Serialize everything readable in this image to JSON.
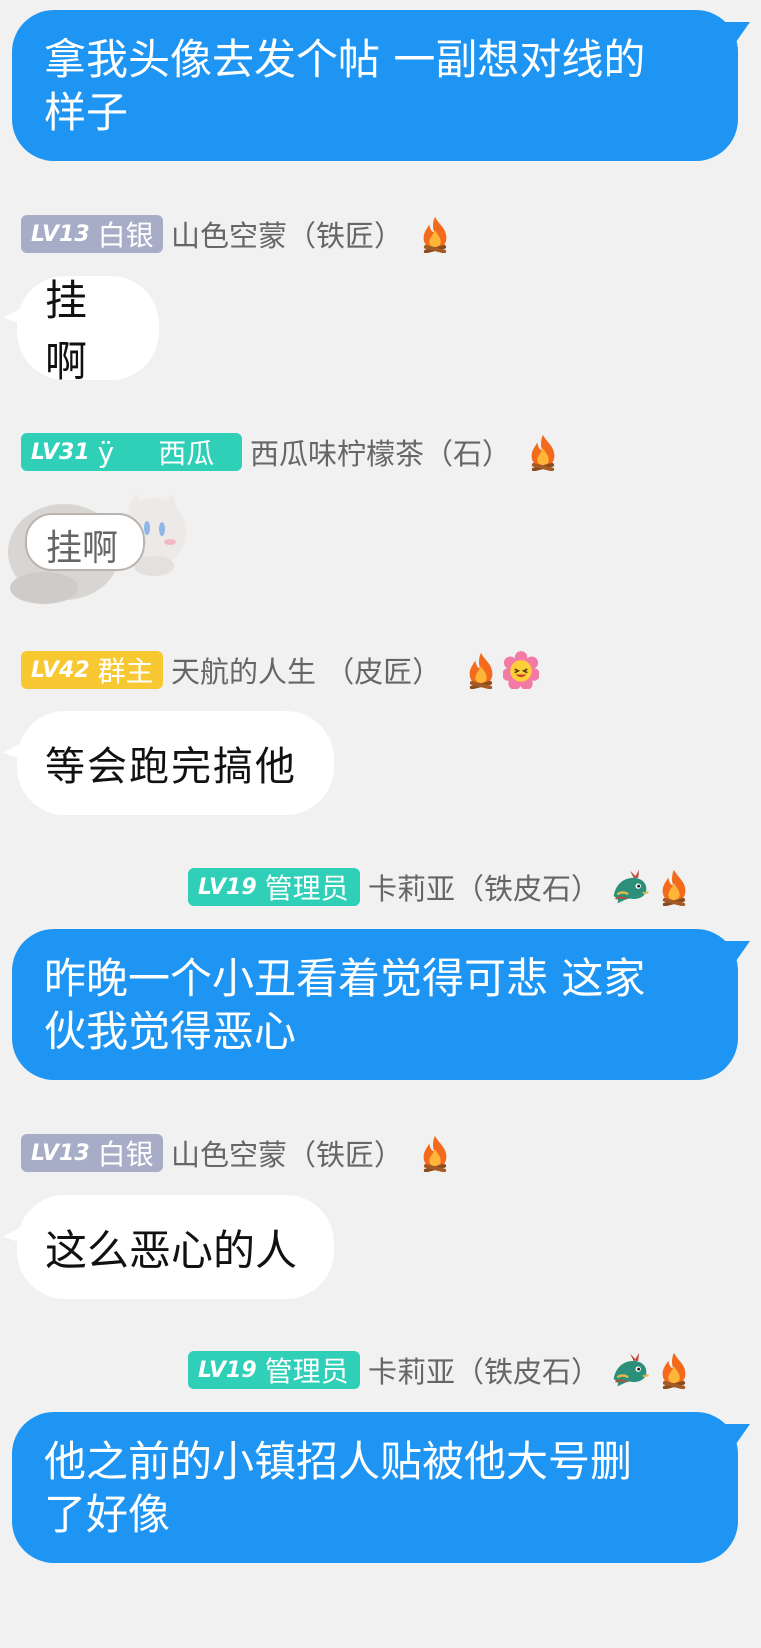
{
  "colors": {
    "background": "#f1f1f1",
    "outgoing_bubble": "#1e95f3",
    "badge_silver": "#a7acc7",
    "badge_teal": "#2fcfb8",
    "badge_owner": "#f8c832"
  },
  "messages": [
    {
      "type": "outgoing",
      "lines": [
        "拿我头像去发个帖  一副想对线的",
        "样子"
      ]
    },
    {
      "type": "header",
      "level": "LV13",
      "title": "白银",
      "name": "山色空蒙（铁匠）",
      "icons": [
        "fire-icon"
      ]
    },
    {
      "type": "incoming",
      "text": "挂啊"
    },
    {
      "type": "header",
      "level": "LV31",
      "title_prefix": "ÿ",
      "title": "西瓜",
      "name": "西瓜味柠檬茶（石）",
      "icons": [
        "fire-icon"
      ]
    },
    {
      "type": "sticker",
      "text": "挂啊"
    },
    {
      "type": "header",
      "level": "LV42",
      "title": "群主",
      "name": "天航的人生 （皮匠）",
      "icons": [
        "fire-icon",
        "flower-face-icon"
      ]
    },
    {
      "type": "incoming",
      "text": "等会跑完搞他"
    },
    {
      "type": "header",
      "level": "LV19",
      "title": "管理员",
      "name": "卡莉亚（铁皮石）",
      "icons": [
        "dragon-icon",
        "fire-icon"
      ]
    },
    {
      "type": "outgoing",
      "lines": [
        "昨晚一个小丑看着觉得可悲  这家",
        "伙我觉得恶心"
      ]
    },
    {
      "type": "header",
      "level": "LV13",
      "title": "白银",
      "name": "山色空蒙（铁匠）",
      "icons": [
        "fire-icon"
      ]
    },
    {
      "type": "incoming",
      "text": "这么恶心的人"
    },
    {
      "type": "header",
      "level": "LV19",
      "title": "管理员",
      "name": "卡莉亚（铁皮石）",
      "icons": [
        "dragon-icon",
        "fire-icon"
      ]
    },
    {
      "type": "outgoing",
      "lines": [
        "他之前的小镇招人贴被他大号删",
        "了好像"
      ]
    }
  ]
}
